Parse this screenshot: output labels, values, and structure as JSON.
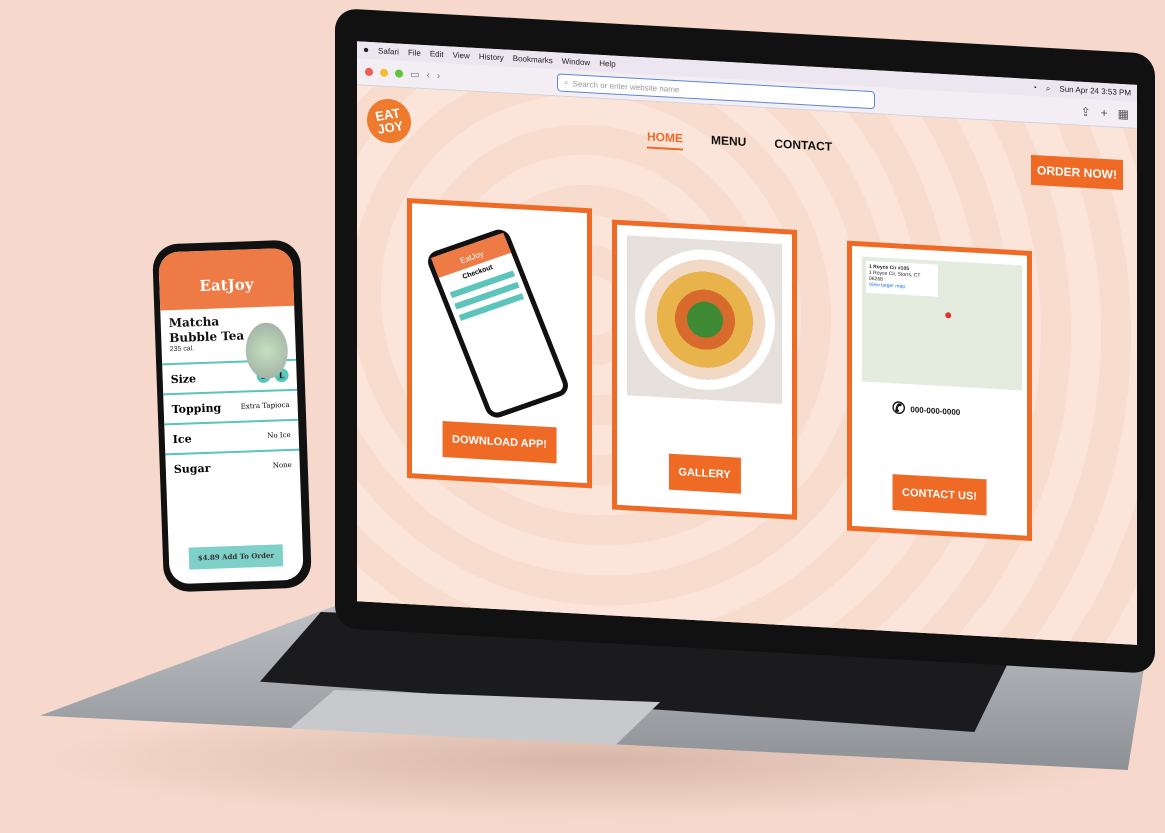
{
  "menubar": {
    "apple": "",
    "items": [
      "Safari",
      "File",
      "Edit",
      "View",
      "History",
      "Bookmarks",
      "Window",
      "Help"
    ],
    "clock": "Sun Apr 24  3:53 PM"
  },
  "browser": {
    "address_placeholder": "Search or enter website name"
  },
  "site": {
    "logo_line1": "EAT",
    "logo_line2": "JOY",
    "nav": {
      "home": "HOME",
      "menu": "MENU",
      "contact": "CONTACT"
    },
    "order_button": "ORDER NOW!",
    "cards": {
      "download_button": "DOWNLOAD APP!",
      "gallery_button": "GALLERY",
      "contact_button": "CONTACT US!",
      "phone_number": "000-000-0000",
      "map_address_line1": "1 Royce Cir #105",
      "map_address_line2": "1 Royce Cir, Storrs, CT 06268",
      "map_link": "View larger map"
    },
    "mini_app": {
      "header": "EatJoy",
      "title": "Checkout"
    }
  },
  "phone_app": {
    "header": "EatJoy",
    "title_line1": "Matcha",
    "title_line2": "Bubble Tea",
    "calories": "235 cal.",
    "size_label": "Size",
    "size_s": "S",
    "size_l": "L",
    "topping_label": "Topping",
    "topping_value": "Extra Tapioca",
    "ice_label": "Ice",
    "ice_value": "No Ice",
    "sugar_label": "Sugar",
    "sugar_value": "None",
    "add_button": "$4.89 Add To Order"
  },
  "colors": {
    "brand_orange": "#ee6a25",
    "teal": "#5bc4bb"
  }
}
